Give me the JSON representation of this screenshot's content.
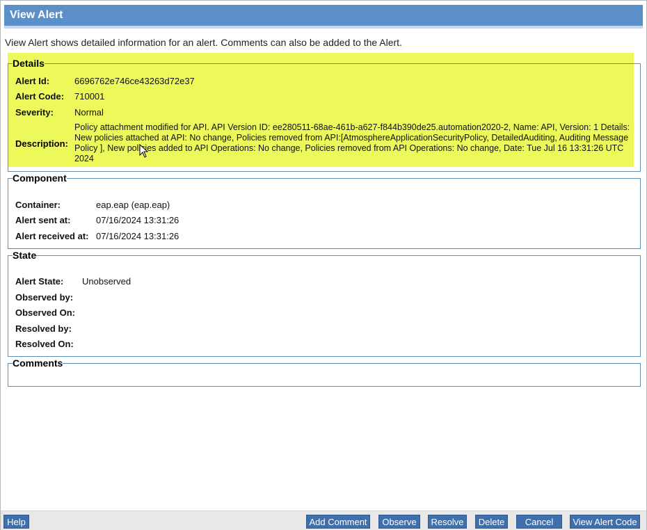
{
  "header": {
    "title": "View Alert"
  },
  "intro": "View Alert shows detailed information for an alert. Comments can also be added to the Alert.",
  "details": {
    "legend": "Details",
    "alert_id_label": "Alert Id:",
    "alert_id_value": "6696762e746ce43263d72e37",
    "alert_code_label": "Alert Code:",
    "alert_code_value": "710001",
    "severity_label": "Severity:",
    "severity_value": "Normal",
    "description_label": "Description:",
    "description_value": "Policy attachment modified for API. API Version ID: ee280511-68ae-461b-a627-f844b390de25.automation2020-2, Name: API, Version: 1 Details: New policies attached at API: No change, Policies removed from API:[AtmosphereApplicationSecurityPolicy, DetailedAuditing, Auditing Message Policy ], New policies added to API Operations: No change, Policies removed from API Operations: No change, Date: Tue Jul 16 13:31:26 UTC 2024"
  },
  "component": {
    "legend": "Component",
    "container_label": "Container:",
    "container_value": "eap.eap (eap.eap)",
    "sent_label": "Alert sent at:",
    "sent_value": "07/16/2024 13:31:26",
    "received_label": "Alert received at:",
    "received_value": "07/16/2024 13:31:26"
  },
  "state": {
    "legend": "State",
    "alert_state_label": "Alert State:",
    "alert_state_value": "Unobserved",
    "observed_by_label": "Observed by:",
    "observed_on_label": "Observed On:",
    "resolved_by_label": "Resolved by:",
    "resolved_on_label": "Resolved On:"
  },
  "comments": {
    "legend": "Comments"
  },
  "buttons": {
    "help": "Help",
    "add_comment": "Add Comment",
    "observe": "Observe",
    "resolve": "Resolve",
    "delete": "Delete",
    "cancel": "Cancel",
    "view_alert_code": "View Alert Code"
  },
  "colors": {
    "title_bar": "#5b8fc8",
    "highlight": "#edf95a",
    "button": "#3f70ad",
    "section_border": "#5b8fb5"
  }
}
